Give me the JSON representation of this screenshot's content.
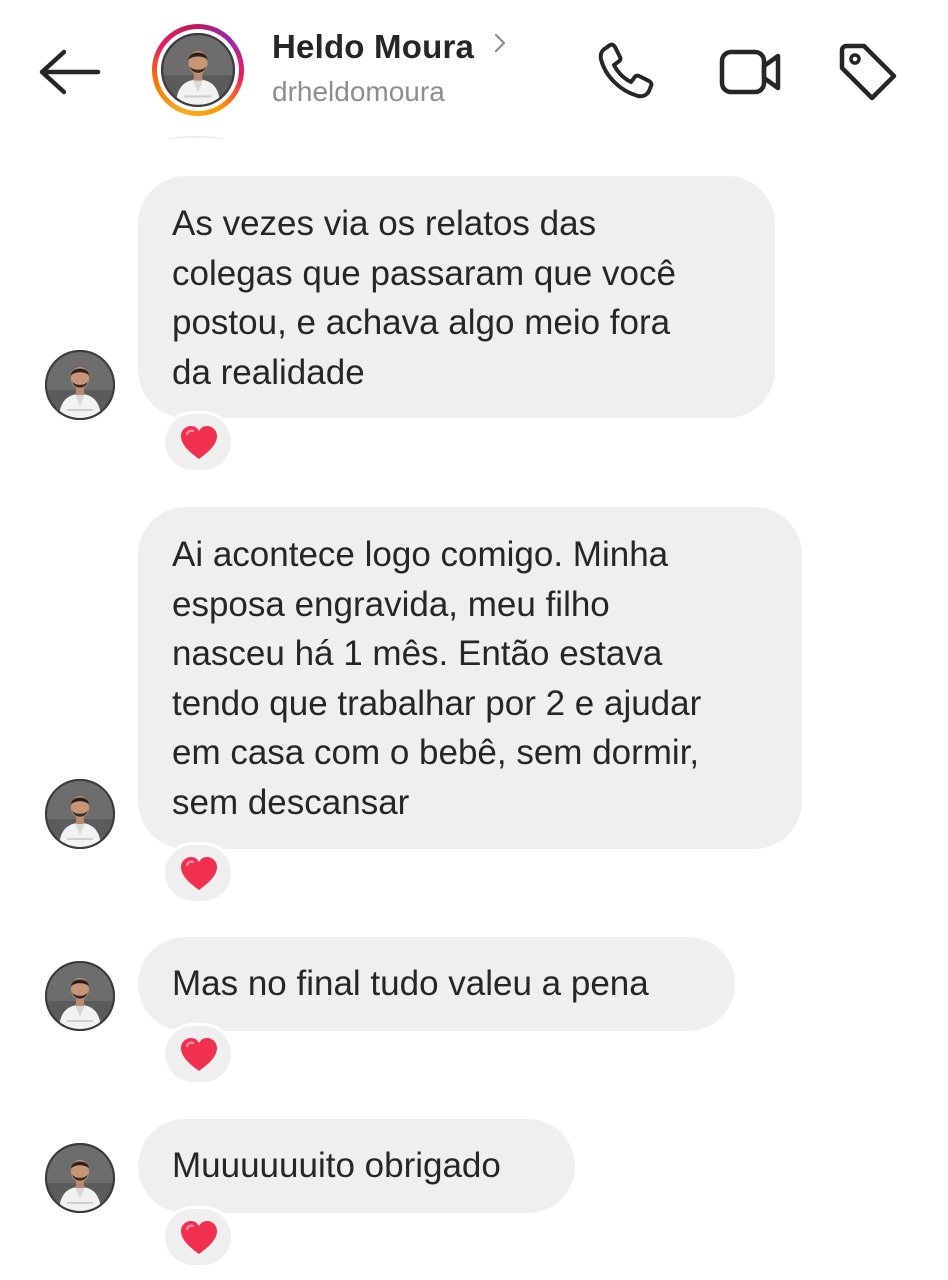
{
  "header": {
    "contact_name": "Heldo Moura",
    "username": "drheldomoura",
    "icons": [
      "back-arrow-icon",
      "chevron-right-icon",
      "phone-icon",
      "video-camera-icon",
      "tag-icon"
    ]
  },
  "colors": {
    "bubble_bg": "#efefef",
    "heart": "#f0304e",
    "username_gray": "#8e8e8e",
    "text": "#262626"
  },
  "messages": [
    {
      "lines": [
        "As vezes via os relatos das",
        "colegas que passaram que você",
        "postou, e achava algo meio fora",
        "da realidade"
      ],
      "reaction": "heart"
    },
    {
      "lines": [
        "Ai acontece logo comigo. Minha",
        "esposa engravida, meu filho",
        "nasceu há 1 mês. Então estava",
        "tendo que trabalhar por 2 e ajudar",
        "em casa com o bebê, sem dormir,",
        "sem descansar"
      ],
      "reaction": "heart"
    },
    {
      "lines": [
        "Mas no final tudo valeu a pena"
      ],
      "reaction": "heart"
    },
    {
      "lines": [
        "Muuuuuuito obrigado"
      ],
      "reaction": "heart"
    }
  ]
}
